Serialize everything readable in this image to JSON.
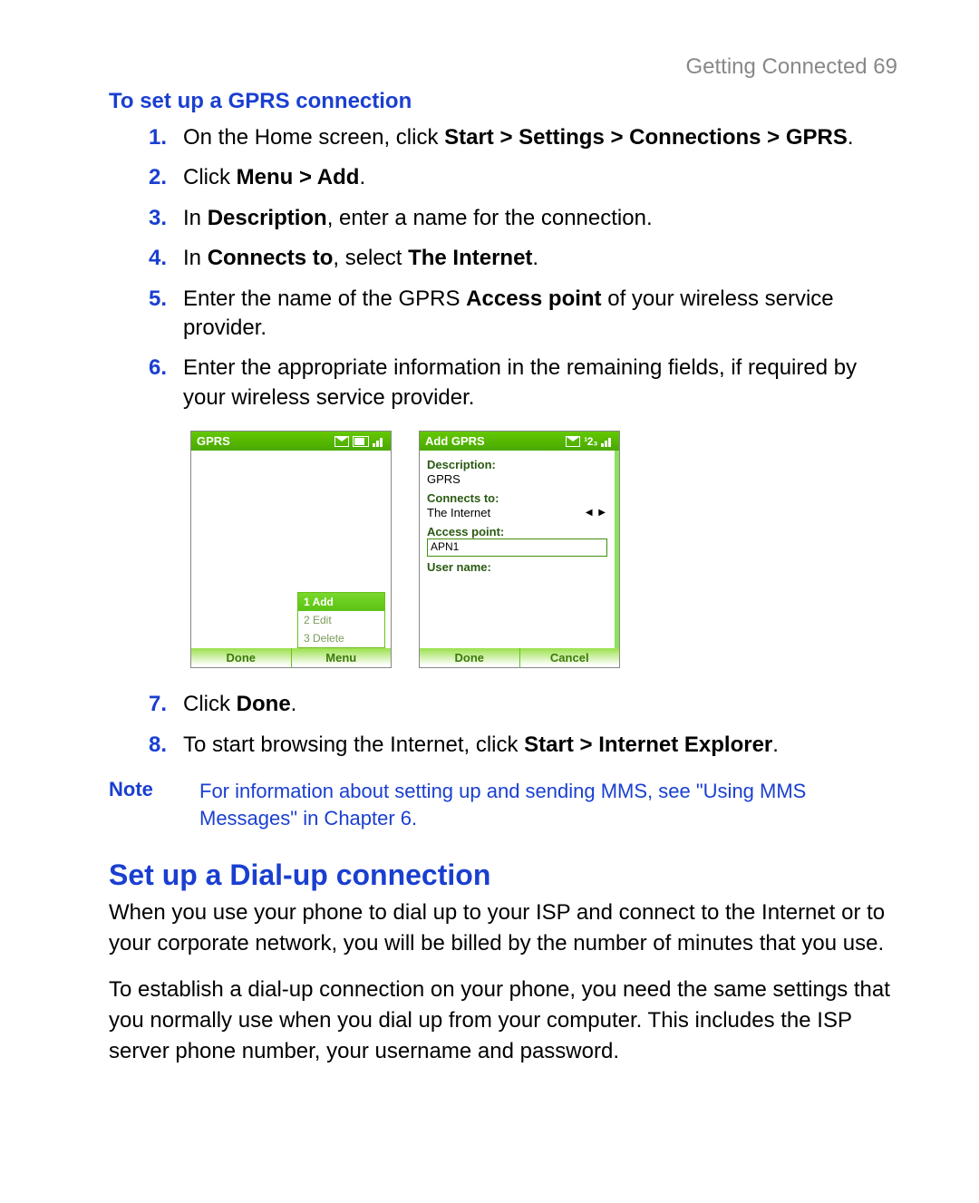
{
  "header": {
    "running": "Getting Connected  69"
  },
  "sec1": {
    "title": "To set up a GPRS connection",
    "steps": [
      {
        "n": "1.",
        "pre": "On the Home screen, click ",
        "b1": "Start > Settings > Connections > GPRS",
        "post": "."
      },
      {
        "n": "2.",
        "pre": "Click ",
        "b1": "Menu > Add",
        "post": "."
      },
      {
        "n": "3.",
        "pre": "In ",
        "b1": "Description",
        "post": ", enter a name for the connection."
      },
      {
        "n": "4.",
        "pre": "In ",
        "b1": "Connects to",
        "mid": ", select ",
        "b2": "The Internet",
        "post": "."
      },
      {
        "n": "5.",
        "pre": "Enter the name of the GPRS ",
        "b1": "Access point",
        "post": " of your wireless service provider."
      },
      {
        "n": "6.",
        "pre": "Enter the appropriate information in the remaining fields, if required by your wireless service provider.",
        "b1": "",
        "post": ""
      }
    ],
    "steps2": [
      {
        "n": "7.",
        "pre": "Click ",
        "b1": "Done",
        "post": "."
      },
      {
        "n": "8.",
        "pre": "To start browsing the Internet, click ",
        "b1": "Start > Internet Explorer",
        "post": "."
      }
    ]
  },
  "screenA": {
    "title": "GPRS",
    "menu": {
      "i1": "1 Add",
      "i2": "2 Edit",
      "i3": "3 Delete"
    },
    "skL": "Done",
    "skR": "Menu"
  },
  "screenB": {
    "title": "Add GPRS",
    "lbl_desc": "Description:",
    "val_desc": "GPRS",
    "lbl_conn": "Connects to:",
    "val_conn": "The Internet",
    "lbl_ap": "Access point:",
    "val_ap": "APN1",
    "lbl_user": "User name:",
    "skL": "Done",
    "skR": "Cancel",
    "status_extra": "¹2₃"
  },
  "note": {
    "label": "Note",
    "text": "For information about setting up and sending MMS, see \"Using MMS Messages\" in Chapter 6."
  },
  "sec2": {
    "title": "Set up a Dial-up connection",
    "p1": "When you use your phone to dial up to your ISP and connect to the Internet or to your corporate network, you will be billed by the number of minutes that you use.",
    "p2": "To establish a dial-up connection on your phone, you need the same settings that you normally use when you dial up from your computer. This includes the ISP server phone number, your username and password."
  }
}
